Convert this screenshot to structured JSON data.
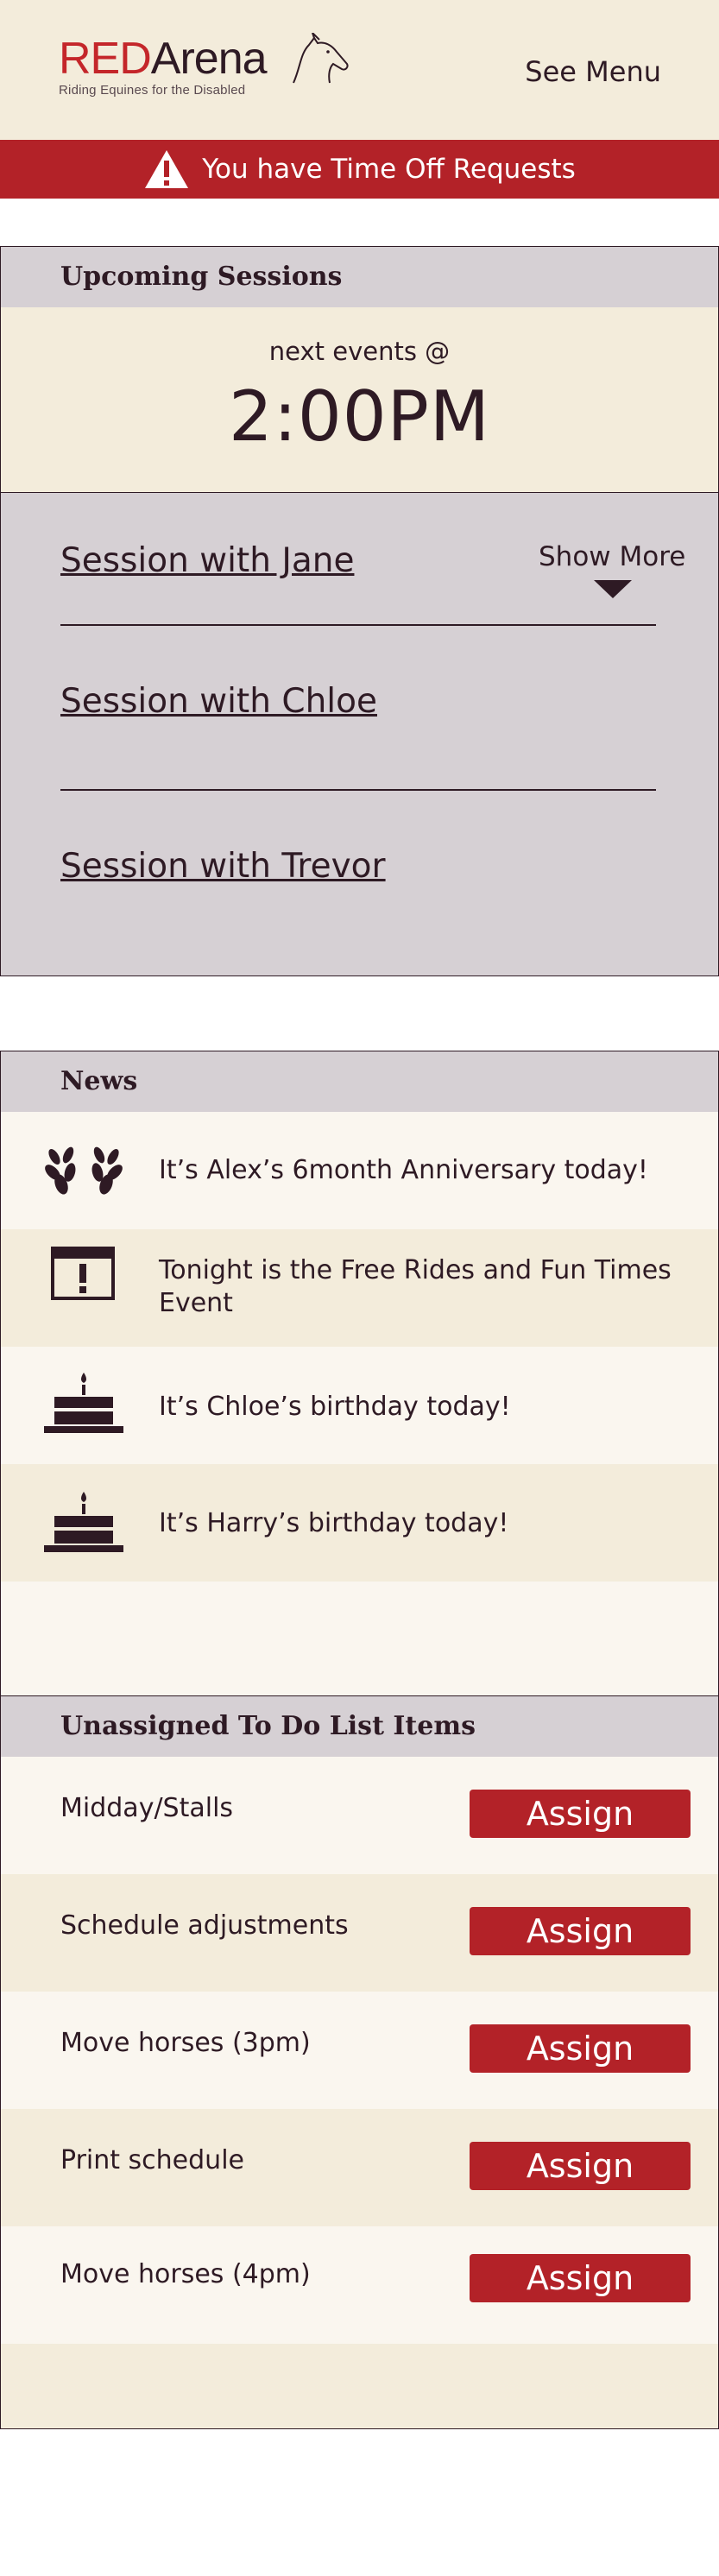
{
  "header": {
    "logo_red": "RED",
    "logo_arena": "Arena",
    "logo_tagline": "Riding Equines for the Disabled",
    "menu_label": "See Menu"
  },
  "alert": {
    "icon": "warning-icon",
    "text": "You have Time Off Requests"
  },
  "upcoming": {
    "heading": "Upcoming Sessions",
    "next_label": "next events @",
    "next_time": "2:00PM",
    "sessions": [
      "Session with Jane",
      "Session with Chloe",
      "Session with Trevor"
    ],
    "show_more": "Show More"
  },
  "news": {
    "heading": "News",
    "items": [
      {
        "icon": "laurel-icon",
        "text": "It’s Alex’s 6month Anniversary today!"
      },
      {
        "icon": "calendar-alert-icon",
        "text": "Tonight is the Free Rides and Fun Times Event"
      },
      {
        "icon": "birthday-cake-icon",
        "text": "It’s Chloe’s birthday today!"
      },
      {
        "icon": "birthday-cake-icon",
        "text": "It’s Harry’s birthday today!"
      }
    ]
  },
  "todo": {
    "heading": "Unassigned To Do List Items",
    "items": [
      {
        "label": "Midday/Stalls",
        "button": "Assign"
      },
      {
        "label": "Schedule adjustments",
        "button": "Assign"
      },
      {
        "label": "Move horses (3pm)",
        "button": "Assign"
      },
      {
        "label": "Print schedule",
        "button": "Assign"
      },
      {
        "label": "Move horses (4pm)",
        "button": "Assign"
      }
    ]
  },
  "colors": {
    "accent": "#b32228",
    "cream": "#f3ecdb",
    "grey": "#d6d0d4",
    "text": "#2e1a24"
  }
}
